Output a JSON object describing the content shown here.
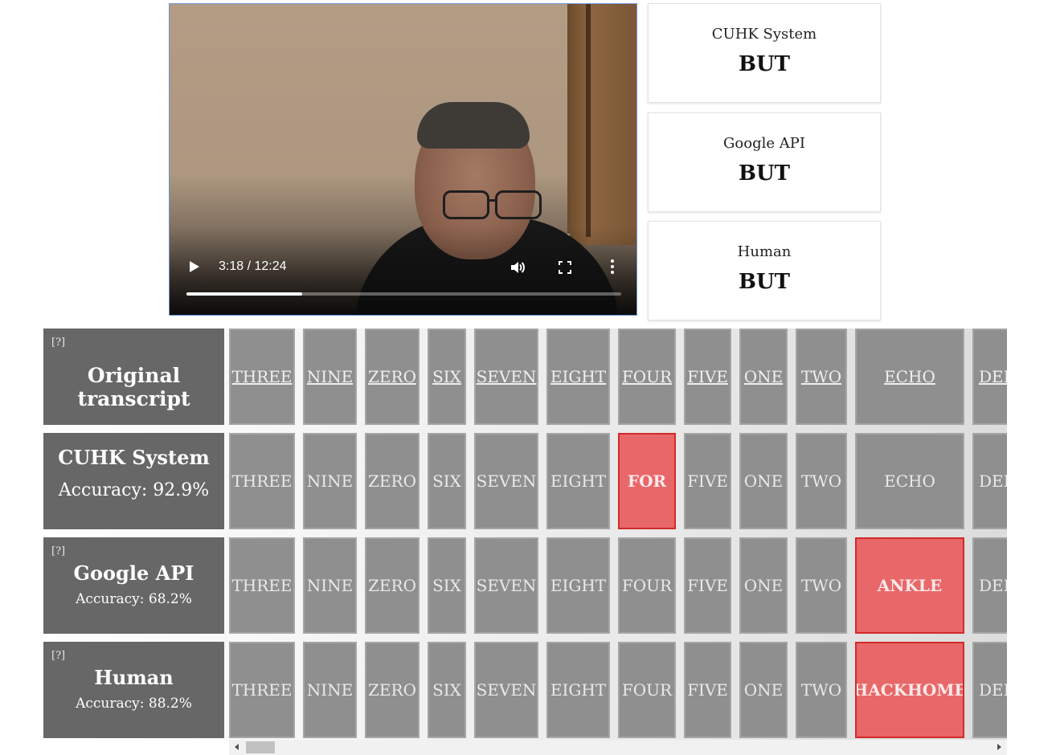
{
  "video": {
    "time": "3:18 / 12:24",
    "progress": 0.266
  },
  "cards": [
    {
      "title": "CUHK System",
      "word": "BUT"
    },
    {
      "title": "Google API",
      "word": "BUT"
    },
    {
      "title": "Human",
      "word": "BUT"
    }
  ],
  "rows": [
    {
      "help": "[?]",
      "name": "Original transcript",
      "accuracy": ""
    },
    {
      "help": "",
      "name": "CUHK System",
      "accuracy": "Accuracy: 92.9%"
    },
    {
      "help": "[?]",
      "name": "Google API",
      "accuracy": "Accuracy: 68.2%"
    },
    {
      "help": "[?]",
      "name": "Human",
      "accuracy": "Accuracy: 88.2%"
    }
  ],
  "grid": [
    [
      "THREE",
      "NINE",
      "ZERO",
      "SIX",
      "SEVEN",
      "EIGHT",
      "FOUR",
      "FIVE",
      "ONE",
      "TWO",
      "ECHO",
      "DEL"
    ],
    [
      "THREE",
      "NINE",
      "ZERO",
      "SIX",
      "SEVEN",
      "EIGHT",
      "FOR",
      "FIVE",
      "ONE",
      "TWO",
      "ECHO",
      "DEL"
    ],
    [
      "THREE",
      "NINE",
      "ZERO",
      "SIX",
      "SEVEN",
      "EIGHT",
      "FOUR",
      "FIVE",
      "ONE",
      "TWO",
      "ANKLE",
      "DEL"
    ],
    [
      "THREE",
      "NINE",
      "ZERO",
      "SIX",
      "SEVEN",
      "EIGHT",
      "FOUR",
      "FIVE",
      "ONE",
      "TWO",
      "HACKHOME",
      "DEL"
    ]
  ],
  "colors": {
    "label_bg": "#676767",
    "cell_bg": "#8f8f8f",
    "error_bg": "#e8686a",
    "error_border": "#d22a2a"
  }
}
